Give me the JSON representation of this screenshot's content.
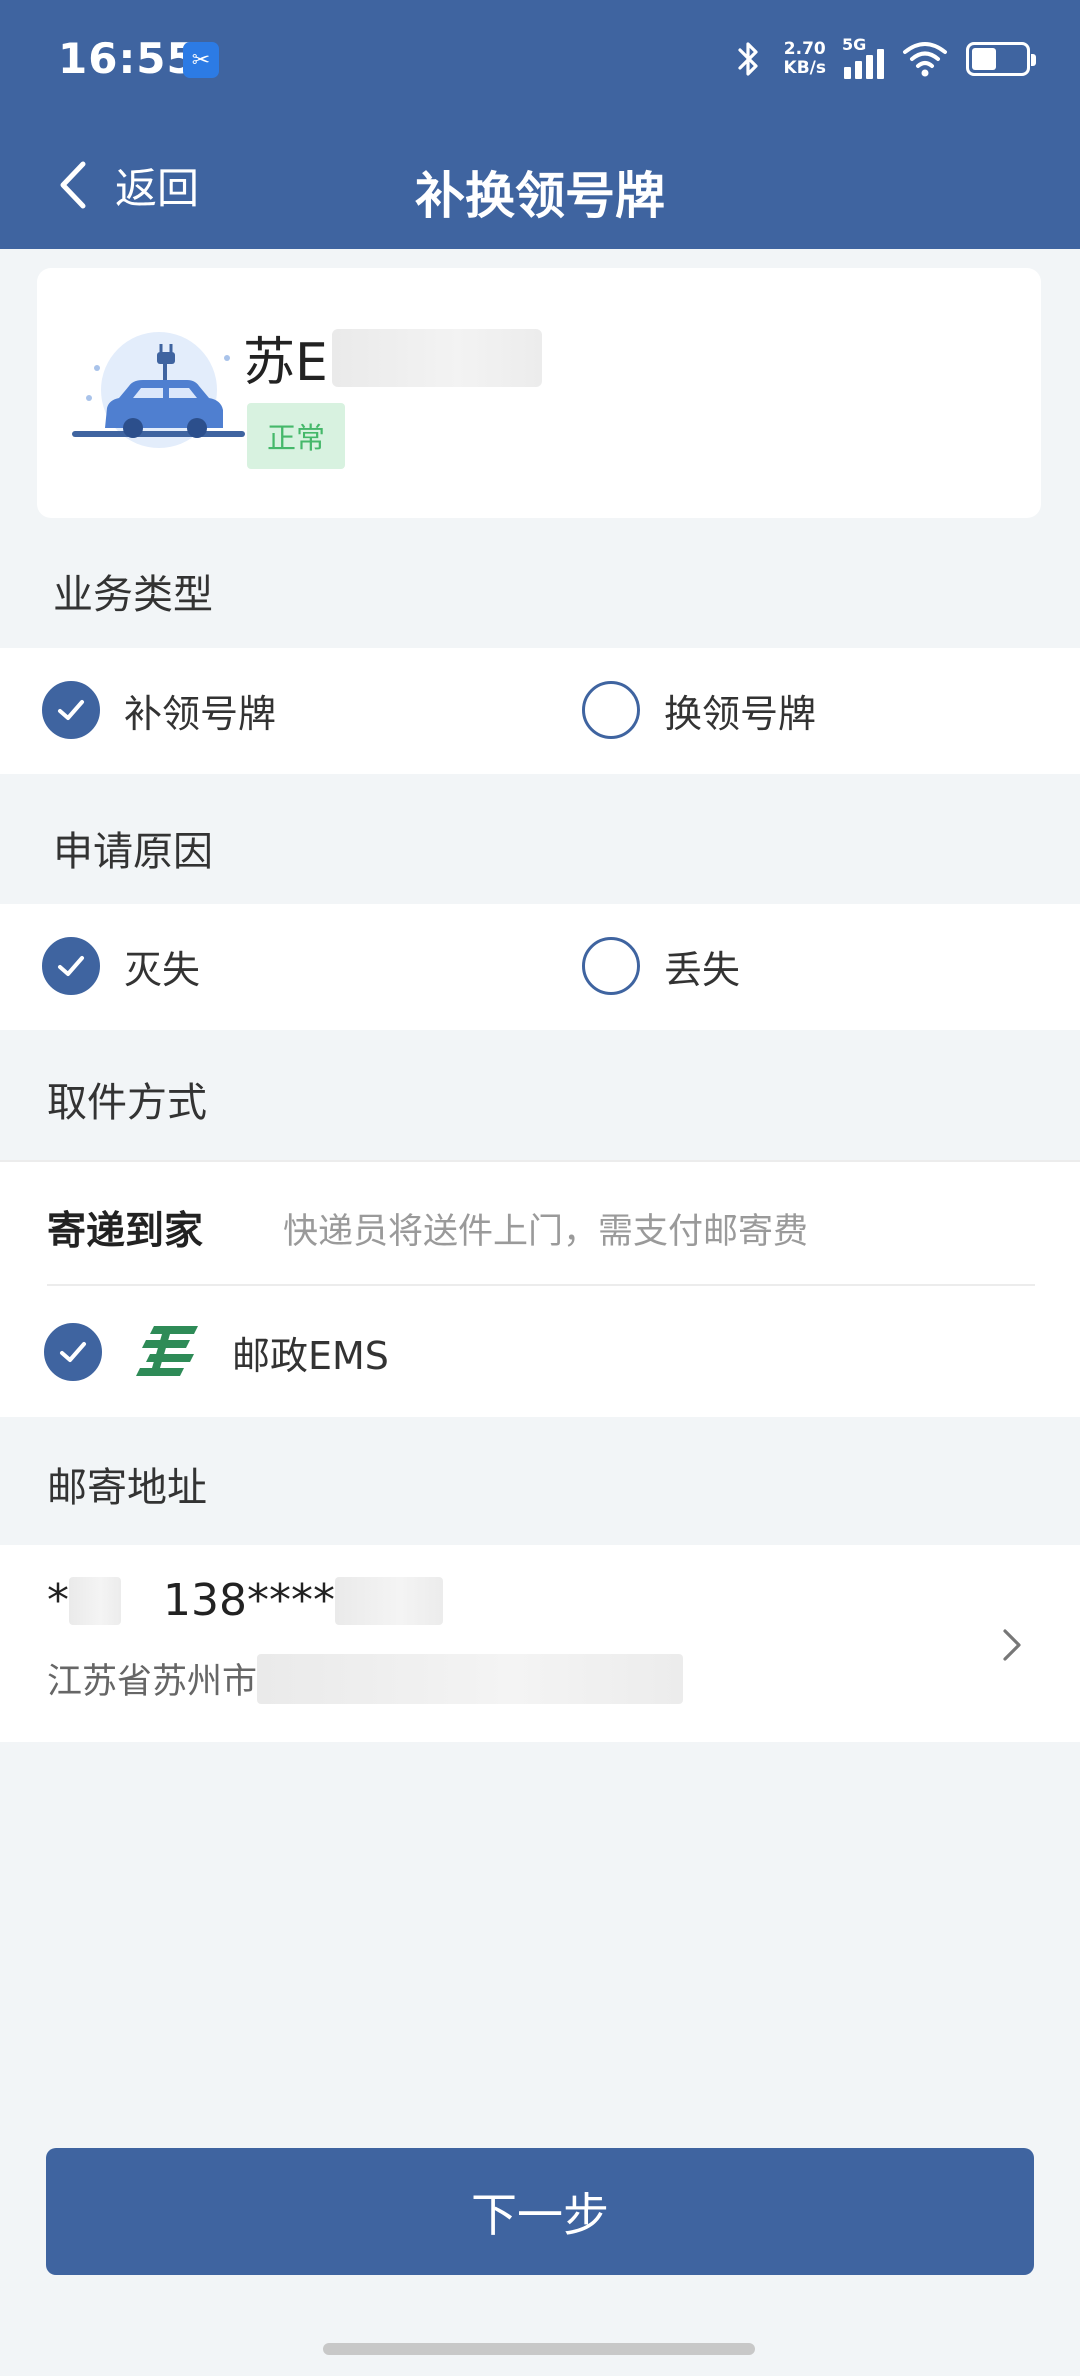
{
  "status_bar": {
    "time": "16:55",
    "speed_value": "2.70",
    "speed_unit": "KB/s",
    "network": "5G"
  },
  "nav": {
    "back_label": "返回",
    "title": "补换领号牌"
  },
  "vehicle": {
    "plate_prefix": "苏E",
    "status": "正常"
  },
  "business_type": {
    "label": "业务类型",
    "options": [
      {
        "label": "补领号牌",
        "checked": true
      },
      {
        "label": "换领号牌",
        "checked": false
      }
    ]
  },
  "reason": {
    "label": "申请原因",
    "options": [
      {
        "label": "灭失",
        "checked": true
      },
      {
        "label": "丢失",
        "checked": false
      }
    ]
  },
  "pickup": {
    "label": "取件方式",
    "delivery_title": "寄递到家",
    "delivery_desc": "快递员将送件上门，需支付邮寄费",
    "carrier": "邮政EMS",
    "carrier_checked": true
  },
  "address": {
    "label": "邮寄地址",
    "name_prefix": "*",
    "phone_prefix": "138****",
    "detail_prefix": "江苏省苏州市"
  },
  "actions": {
    "next_label": "下一步"
  },
  "colors": {
    "primary": "#3f64a0",
    "badge_bg": "#d8f2e0",
    "badge_text": "#45b86a",
    "ems_green": "#2e8b57"
  }
}
